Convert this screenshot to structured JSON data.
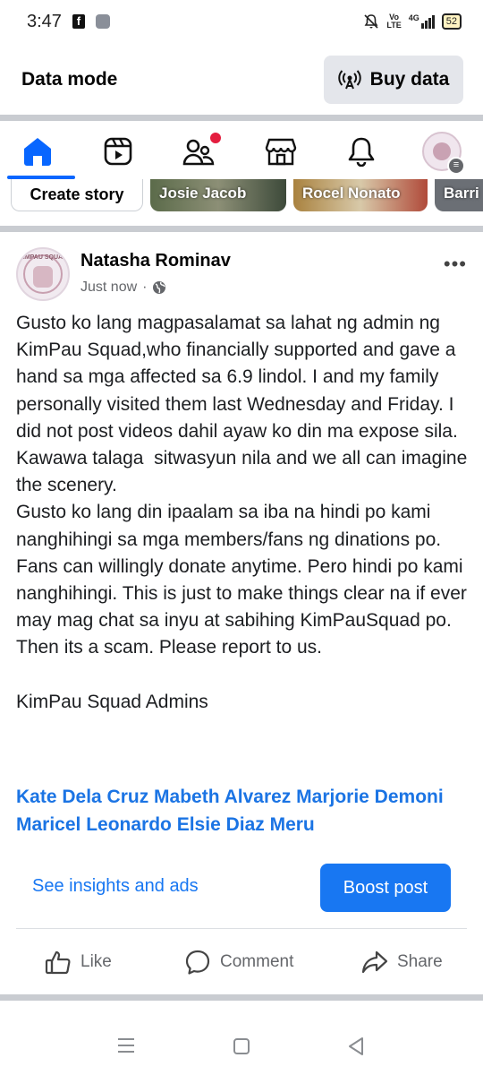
{
  "status_bar": {
    "time": "3:47",
    "network_label_top": "Vo",
    "network_label_bottom": "LTE",
    "network_type": "4G",
    "battery": "52"
  },
  "top_bar": {
    "title": "Data mode",
    "buy_data_label": "Buy data"
  },
  "nav": {
    "items": [
      "home-icon",
      "video-icon",
      "friends-icon",
      "marketplace-icon",
      "notifications-icon",
      "profile-avatar"
    ],
    "active_color": "#0866ff",
    "badge_color": "#e41e3f"
  },
  "stories": {
    "create_label": "Create story",
    "cards": [
      "Josie Jacob",
      "Rocel Nonato",
      "Barri"
    ]
  },
  "post": {
    "author": "Natasha Rominav",
    "time": "Just now",
    "audience_icon": "globe-icon",
    "avatar_text": "KIMPAU SQUAD",
    "body": "Gusto ko lang magpasalamat sa lahat ng admin ng KimPau Squad,who financially supported and gave a hand sa mga affected sa 6.9 lindol. I and my family personally visited them last Wednesday and Friday. I did not post videos dahil ayaw ko din ma expose sila. Kawawa talaga  sitwasyun nila and we all can imagine the scenery.\nGusto ko lang din ipaalam sa iba na hindi po kami nanghihingi sa mga members/fans ng dinations po. Fans can willingly donate anytime. Pero hindi po kami nanghihingi. This is just to make things clear na if ever may mag chat sa inyu at sabihing KimPauSquad po. Then its a scam. Please report to us.\n\nKimPau Squad Admins",
    "tags": "Kate Dela Cruz Mabeth Alvarez Marjorie Demoni Maricel Leonardo Elsie Diaz Meru",
    "insights_label": "See insights and ads",
    "boost_label": "Boost post"
  },
  "actions": {
    "like": "Like",
    "comment": "Comment",
    "share": "Share"
  },
  "colors": {
    "link_blue": "#1877f2",
    "tag_blue": "#1b74e4",
    "divider": "#c9ccd1"
  }
}
